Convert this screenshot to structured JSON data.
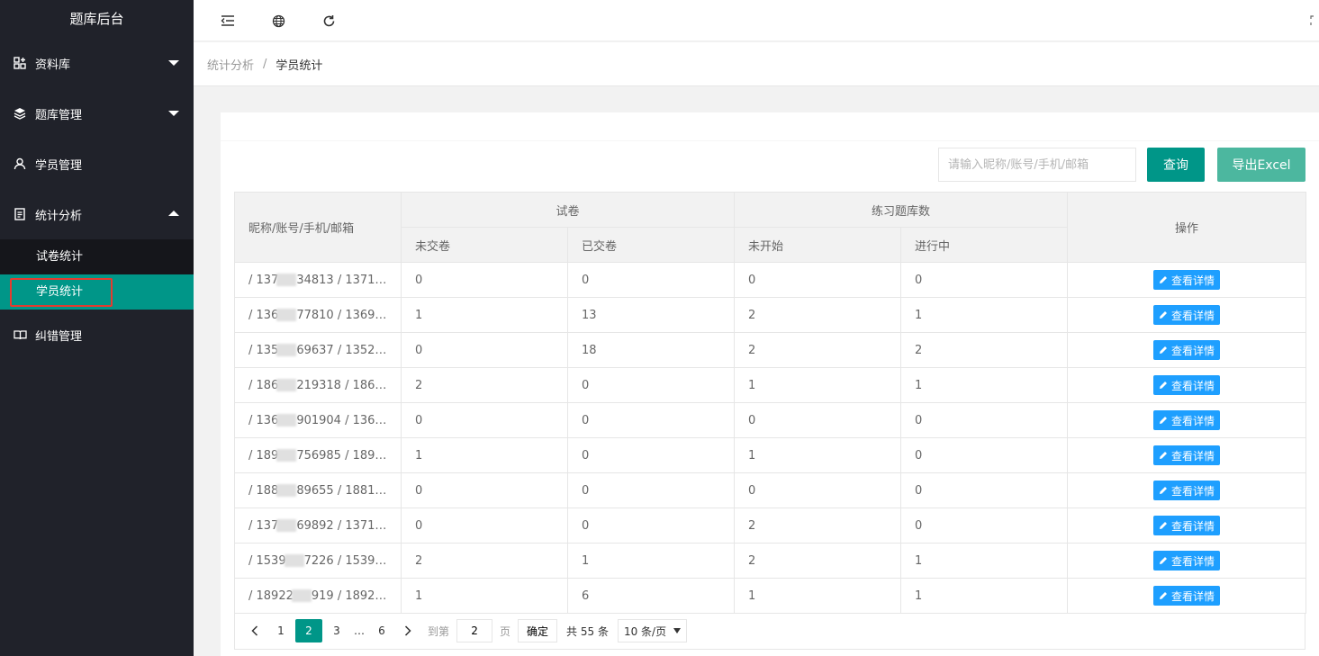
{
  "app": {
    "title": "题库后台"
  },
  "sidebar": {
    "items": [
      {
        "label": "资料库",
        "icon": "grid-icon",
        "expanded": false
      },
      {
        "label": "题库管理",
        "icon": "layers-icon",
        "expanded": false
      },
      {
        "label": "学员管理",
        "icon": "user-icon"
      },
      {
        "label": "统计分析",
        "icon": "document-icon",
        "expanded": true
      },
      {
        "label": "纠错管理",
        "icon": "book-icon"
      }
    ],
    "sub_items": [
      {
        "label": "试卷统计"
      },
      {
        "label": "学员统计",
        "active": true
      }
    ]
  },
  "breadcrumb": {
    "parent": "统计分析",
    "separator": "/",
    "current": "学员统计"
  },
  "search": {
    "placeholder": "请输入昵称/账号/手机/邮箱",
    "value": ""
  },
  "buttons": {
    "query": "查询",
    "export": "导出Excel"
  },
  "table": {
    "headers": {
      "account": "昵称/账号/手机/邮箱",
      "paper_group": "试卷",
      "paper_unsubmitted": "未交卷",
      "paper_submitted": "已交卷",
      "practice_group": "练习题库数",
      "practice_not_started": "未开始",
      "practice_in_progress": "进行中",
      "operation": "操作"
    },
    "detail_label": "查看详情",
    "rows": [
      {
        "pre": "/ 137",
        "post": "34813 / 1371…",
        "c1": "0",
        "c2": "0",
        "c3": "0",
        "c4": "0"
      },
      {
        "pre": "/ 136",
        "post": "77810 / 1369…",
        "c1": "1",
        "c2": "13",
        "c3": "2",
        "c4": "1"
      },
      {
        "pre": "/ 135",
        "post": "69637 / 1352…",
        "c1": "0",
        "c2": "18",
        "c3": "2",
        "c4": "2"
      },
      {
        "pre": "/ 186",
        "post": "219318 / 1861…",
        "c1": "2",
        "c2": "0",
        "c3": "1",
        "c4": "1"
      },
      {
        "pre": "/ 136",
        "post": "901904 / 1364…",
        "c1": "0",
        "c2": "0",
        "c3": "0",
        "c4": "0"
      },
      {
        "pre": "/ 189",
        "post": "756985 / 1892…",
        "c1": "1",
        "c2": "0",
        "c3": "1",
        "c4": "0"
      },
      {
        "pre": "/ 188",
        "post": "89655 / 1881…",
        "c1": "0",
        "c2": "0",
        "c3": "0",
        "c4": "0"
      },
      {
        "pre": "/ 137",
        "post": "69892 / 1371…",
        "c1": "0",
        "c2": "0",
        "c3": "2",
        "c4": "0"
      },
      {
        "pre": "/ 1539",
        "post": "7226 / 1539…",
        "c1": "2",
        "c2": "1",
        "c3": "2",
        "c4": "1"
      },
      {
        "pre": "/ 18922",
        "post": "919 / 1892…",
        "c1": "1",
        "c2": "6",
        "c3": "1",
        "c4": "1"
      }
    ]
  },
  "pager": {
    "pages": [
      "1",
      "2",
      "3",
      "6"
    ],
    "current": "2",
    "ellipsis": "…",
    "goto_label": "到第",
    "goto_value": "2",
    "page_unit": "页",
    "confirm": "确定",
    "total": "共 55 条",
    "page_size": "10 条/页"
  },
  "colors": {
    "sidebar": "#20222a",
    "primary": "#009688",
    "export": "#4cb79f",
    "detail": "#1e9fff",
    "highlight": "#e43b2f"
  }
}
